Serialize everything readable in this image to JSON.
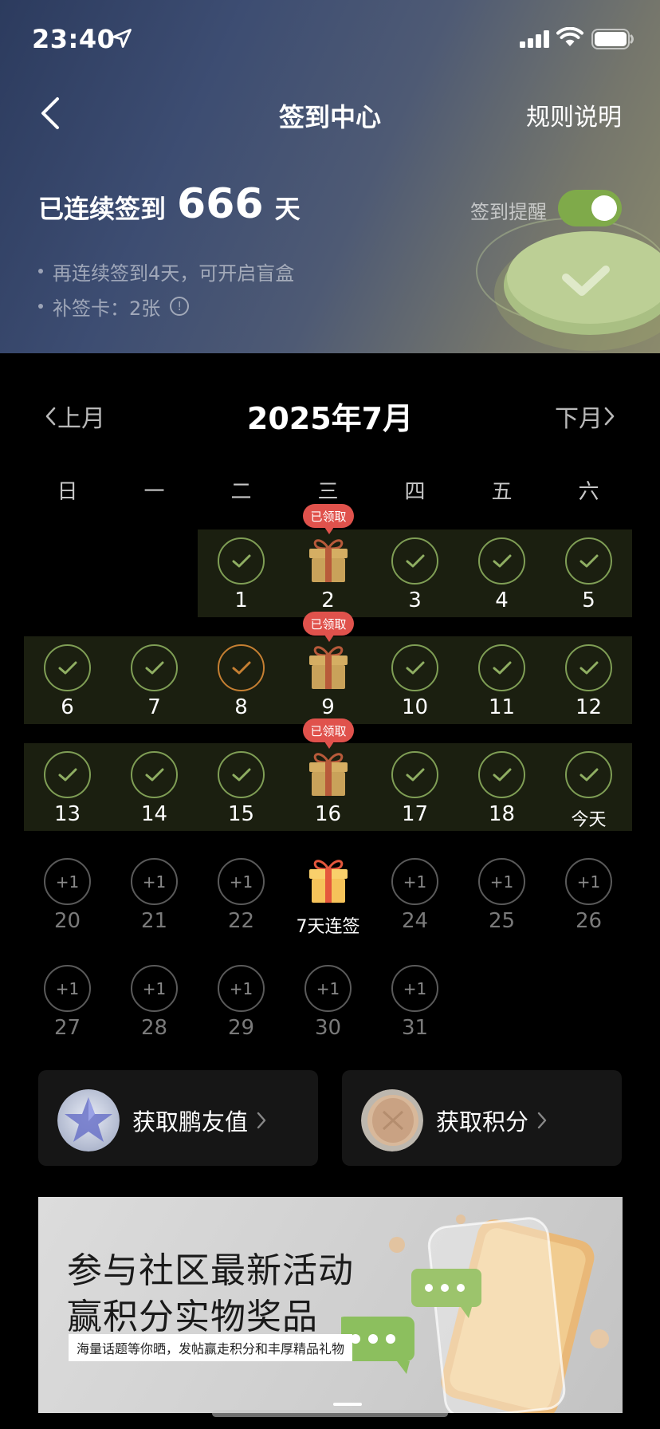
{
  "status_bar": {
    "time": "23:40"
  },
  "nav": {
    "title": "签到中心",
    "rules": "规则说明"
  },
  "streak": {
    "prefix": "已连续签到",
    "days": "666",
    "suffix": "天"
  },
  "reminder": {
    "label": "签到提醒",
    "enabled": true
  },
  "bullets": [
    "再连续签到4天，可开启盲盒",
    "补签卡：2张"
  ],
  "calendar": {
    "title": "2025年7月",
    "prev": "上月",
    "next": "下月",
    "weekdays": [
      "日",
      "一",
      "二",
      "三",
      "四",
      "五",
      "六"
    ],
    "claimed_label": "已领取",
    "future_reward": "+1",
    "today_label": "今天",
    "streak_reward_label": "7天连签",
    "days": [
      {
        "d": "1",
        "state": "done"
      },
      {
        "d": "2",
        "state": "gift-claimed"
      },
      {
        "d": "3",
        "state": "done"
      },
      {
        "d": "4",
        "state": "done"
      },
      {
        "d": "5",
        "state": "done"
      },
      {
        "d": "6",
        "state": "done"
      },
      {
        "d": "7",
        "state": "done"
      },
      {
        "d": "8",
        "state": "late"
      },
      {
        "d": "9",
        "state": "gift-claimed"
      },
      {
        "d": "10",
        "state": "done"
      },
      {
        "d": "11",
        "state": "done"
      },
      {
        "d": "12",
        "state": "done"
      },
      {
        "d": "13",
        "state": "done"
      },
      {
        "d": "14",
        "state": "done"
      },
      {
        "d": "15",
        "state": "done"
      },
      {
        "d": "16",
        "state": "gift-claimed"
      },
      {
        "d": "17",
        "state": "done"
      },
      {
        "d": "18",
        "state": "done"
      },
      {
        "d": "今天",
        "state": "done-today"
      },
      {
        "d": "20",
        "state": "future"
      },
      {
        "d": "21",
        "state": "future"
      },
      {
        "d": "22",
        "state": "future"
      },
      {
        "d": "7天连签",
        "state": "gift-future"
      },
      {
        "d": "24",
        "state": "future"
      },
      {
        "d": "25",
        "state": "future"
      },
      {
        "d": "26",
        "state": "future"
      },
      {
        "d": "27",
        "state": "future"
      },
      {
        "d": "28",
        "state": "future"
      },
      {
        "d": "29",
        "state": "future"
      },
      {
        "d": "30",
        "state": "future"
      },
      {
        "d": "31",
        "state": "future"
      }
    ]
  },
  "cards": {
    "friend_value": "获取鹏友值",
    "points": "获取积分"
  },
  "banner": {
    "line1": "参与社区最新活动",
    "line2": "赢积分实物奖品",
    "sub": "海量话题等你晒，发帖赢走积分和丰厚精品礼物"
  },
  "colors": {
    "accent_green": "#7faa4a",
    "done_ring": "#7f9e55",
    "late_ring": "#c57f32",
    "claimed_badge": "#e0524c"
  }
}
